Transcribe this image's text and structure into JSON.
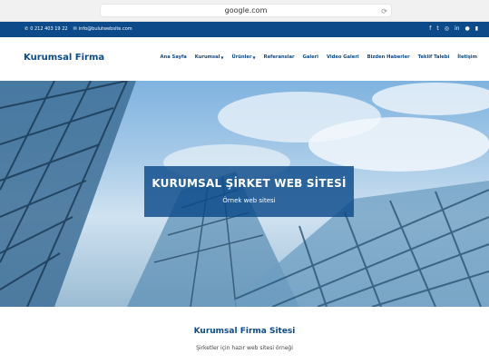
{
  "browser": {
    "url": "google.com"
  },
  "topbar": {
    "phone": "0 212 403 19 22",
    "email": "info@bulutwebsite.com",
    "social_icons": [
      "facebook-icon",
      "twitter-icon",
      "instagram-icon",
      "linkedin-icon",
      "pinterest-icon",
      "youtube-icon"
    ]
  },
  "nav": {
    "logo": "Kurumsal Firma",
    "items": [
      {
        "label": "Ana Sayfa"
      },
      {
        "label": "Kurumsal"
      },
      {
        "label": "Ürünler"
      },
      {
        "label": "Referanslar"
      },
      {
        "label": "Galeri"
      },
      {
        "label": "Video Galeri"
      },
      {
        "label": "Bizden Haberler"
      },
      {
        "label": "Teklif Talebi"
      },
      {
        "label": "İletişim"
      }
    ]
  },
  "hero": {
    "title": "KURUMSAL ŞİRKET WEB SİTESİ",
    "subtitle": "Örnek web sitesi"
  },
  "intro": {
    "title": "Kurumsal Firma Sitesi",
    "subtitle": "Şirketler için hazır web sitesi örneği"
  },
  "colors": {
    "brand": "#0c4a8a",
    "topbar": "#0c4a8a",
    "white": "#ffffff"
  }
}
